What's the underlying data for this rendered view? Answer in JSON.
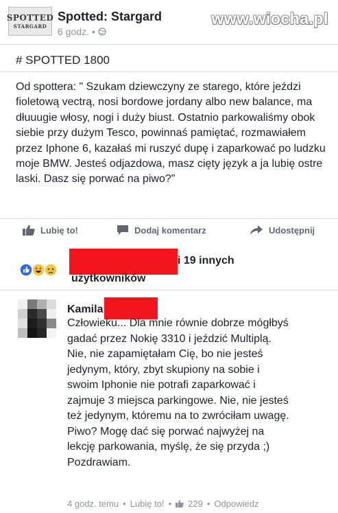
{
  "header": {
    "page_name": "Spotted: Stargard",
    "time": "6 godz.",
    "dot": "•",
    "logo_line1": "SPOTTED",
    "logo_line2": "STARGARD"
  },
  "watermark": "www.wiocha.pl",
  "post": {
    "title": "# SPOTTED 1800",
    "body": "Od spottera: \" Szukam dziewczyny ze starego, które jeździ fioletową vectrą, nosi bordowe jordany albo new balance, ma dłuuugie  włosy, nogi i duży biust. Ostatnio parkowaliśmy obok siebie przy dużym Tesco, powinnaś pamiętać, rozmawiałem przez Iphone 6, kazałaś mi ruszyć dupę i zaparkować po ludzku moje BMW. Jesteś odjazdowa, masz cięty język a ja lubię ostre laski. Dasz się porwać na piwo?\""
  },
  "actions": {
    "like": "Lubię to!",
    "comment": "Dodaj komentarz",
    "share": "Udostępnij"
  },
  "reactions": {
    "others": "i 19 innych",
    "users": "użytkowników"
  },
  "comment": {
    "author": "Kamila",
    "text": "Człowieku... Dla mnie równie dobrze mógłbyś gadać przez Nokię 3310 i jeździć Multiplą. Nie, nie zapamiętałam Cię, bo nie jesteś jedynym, który, zbyt skupiony na sobie i swoim Iphonie nie potrafi zaparkować i zajmuje 3 miejsca parkingowe. Nie, nie jesteś też jedynym, któremu na to zwróciłam uwagę. Piwo? Mogę dać się porwać najwyżej na lekcję parkowania, myślę, że się przyda ;) Pozdrawiam.",
    "time": "4 godz. temu",
    "like": "Lubię to!",
    "like_count": "229",
    "reply": "Odpowiedz",
    "dot": "•"
  },
  "colors": {
    "redaction": "#f2151d",
    "text": "#1d2129",
    "meta": "#90949c",
    "action": "#606770"
  }
}
